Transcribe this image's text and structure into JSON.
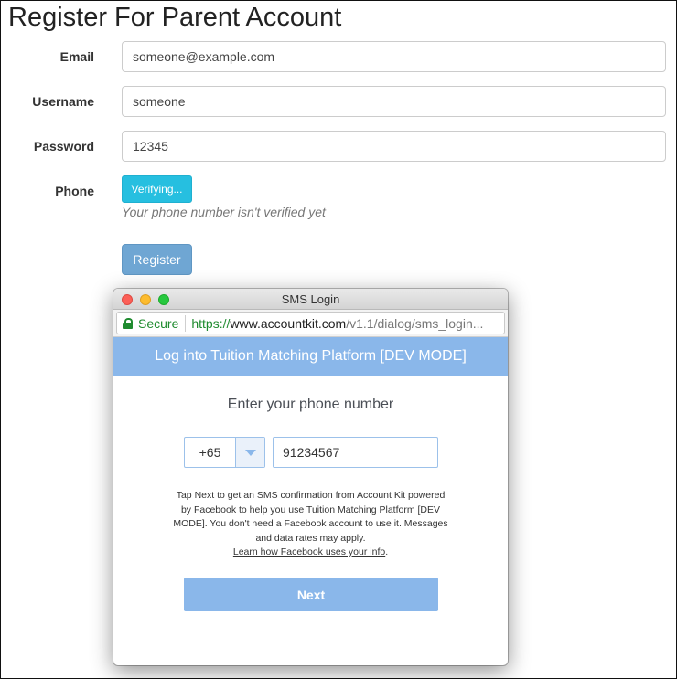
{
  "page": {
    "title": "Register For Parent Account"
  },
  "form": {
    "email_label": "Email",
    "email_value": "someone@example.com",
    "username_label": "Username",
    "username_value": "someone",
    "password_label": "Password",
    "password_value": "12345",
    "phone_label": "Phone",
    "verify_button": "Verifying...",
    "phone_hint": "Your phone number isn't verified yet",
    "register_button": "Register"
  },
  "popup": {
    "window_title": "SMS Login",
    "url": {
      "secure_label": "Secure",
      "scheme": "https://",
      "host": "www.accountkit.com",
      "path": "/v1.1/dialog/sms_login..."
    },
    "header": "Log into Tuition Matching Platform [DEV MODE]",
    "heading": "Enter your phone number",
    "country_code": "+65",
    "phone_number": "91234567",
    "notice": "Tap Next to get an SMS confirmation from Account Kit powered by Facebook to help you use Tuition Matching Platform [DEV MODE]. You don't need a Facebook account to use it. Messages and data rates may apply.",
    "notice_link": "Learn how Facebook uses your info",
    "notice_suffix": ".",
    "next_button": "Next"
  },
  "colors": {
    "verify_button": "#26bfe0",
    "register_button": "#6fa6d3",
    "accountkit_blue": "#8ab7ea",
    "secure_green": "#1f8b2f"
  }
}
